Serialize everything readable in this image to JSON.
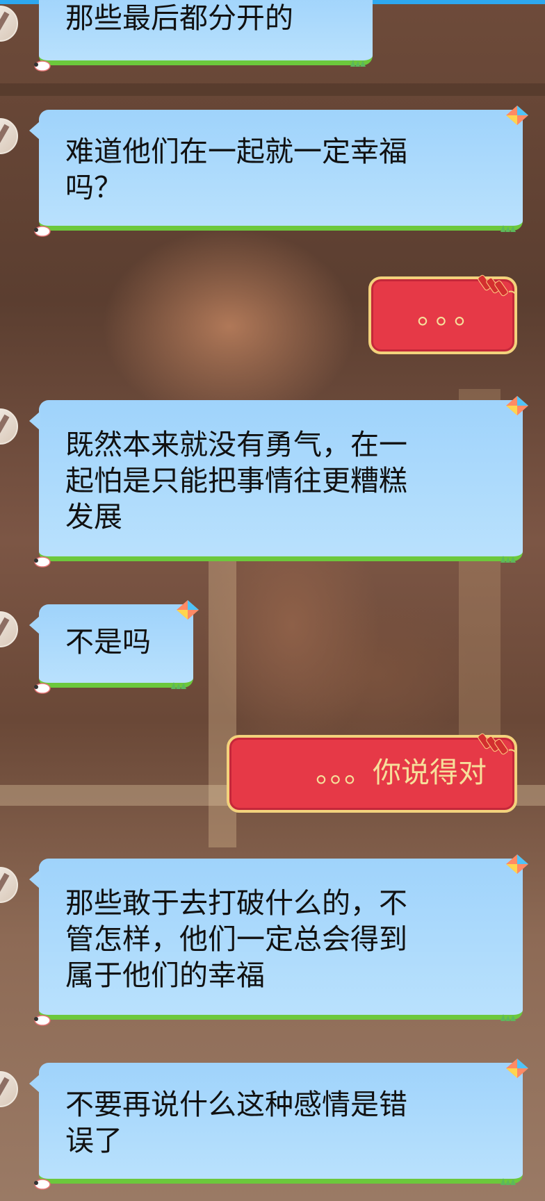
{
  "messages": [
    {
      "side": "left",
      "text": "那些最后都分开的"
    },
    {
      "side": "left",
      "text": "难道他们在一起就一定幸福\n吗？"
    },
    {
      "side": "right",
      "text": "。。。"
    },
    {
      "side": "left",
      "text": "既然本来就没有勇气，在一\n起怕是只能把事情往更糟糕\n发展"
    },
    {
      "side": "left",
      "text": "不是吗"
    },
    {
      "side": "right",
      "text": "。。。你说得对"
    },
    {
      "side": "left",
      "text": "那些敢于去打破什么的，不\n管怎样，他们一定总会得到\n属于他们的幸福"
    },
    {
      "side": "left",
      "text": "不要再说什么这种感情是错\n误了"
    }
  ],
  "colors": {
    "left_bubble": "#a5d6fb",
    "left_bubble_border": "#6cc83c",
    "right_bubble": "#e63947",
    "right_bubble_border": "#f3d27c",
    "top_bar": "#2ea8ef"
  },
  "icons": [
    "kite-icon",
    "sheep-icon",
    "grass-icon",
    "firecracker-icon",
    "avatar"
  ]
}
